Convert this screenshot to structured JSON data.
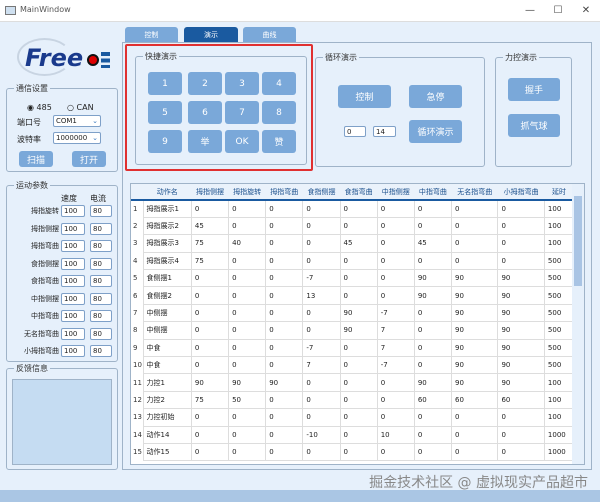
{
  "window": {
    "title": "MainWindow"
  },
  "tabs": [
    {
      "label": "控制"
    },
    {
      "label": "演示"
    },
    {
      "label": "曲线"
    }
  ],
  "logo": {
    "text": "Freelo"
  },
  "comm": {
    "title": "通信设置",
    "radio1": "485",
    "radio2": "CAN",
    "port_label": "端口号",
    "port_value": "COM1",
    "baud_label": "波特率",
    "baud_value": "1000000",
    "scan": "扫描",
    "open": "打开"
  },
  "motion": {
    "title": "运动参数",
    "col_speed": "速度",
    "col_current": "电流",
    "rows": [
      {
        "label": "拇指旋转",
        "speed": "100",
        "current": "80"
      },
      {
        "label": "拇指侧摆",
        "speed": "100",
        "current": "80"
      },
      {
        "label": "拇指弯曲",
        "speed": "100",
        "current": "80"
      },
      {
        "label": "食指侧摆",
        "speed": "100",
        "current": "80"
      },
      {
        "label": "食指弯曲",
        "speed": "100",
        "current": "80"
      },
      {
        "label": "中指侧摆",
        "speed": "100",
        "current": "80"
      },
      {
        "label": "中指弯曲",
        "speed": "100",
        "current": "80"
      },
      {
        "label": "无名指弯曲",
        "speed": "100",
        "current": "80"
      },
      {
        "label": "小拇指弯曲",
        "speed": "100",
        "current": "80"
      }
    ]
  },
  "feedback": {
    "title": "反馈信息"
  },
  "quick": {
    "title": "快捷演示",
    "keys": [
      "1",
      "2",
      "3",
      "4",
      "5",
      "6",
      "7",
      "8",
      "9",
      "举",
      "OK",
      "赞"
    ]
  },
  "loop": {
    "title": "循环演示",
    "control": "控制",
    "stop": "急停",
    "start_value": "0",
    "end_value": "14",
    "loop_btn": "循环演示"
  },
  "force": {
    "title": "力控演示",
    "grip": "握手",
    "ball": "抓气球"
  },
  "table": {
    "headers": [
      "动作名",
      "拇指侧摆",
      "拇指旋转",
      "拇指弯曲",
      "食指侧摆",
      "食指弯曲",
      "中指侧摆",
      "中指弯曲",
      "无名指弯曲",
      "小拇指弯曲",
      "延时"
    ],
    "rows": [
      [
        "1",
        "拇指展示1",
        "0",
        "0",
        "0",
        "0",
        "0",
        "0",
        "0",
        "0",
        "0",
        "100"
      ],
      [
        "2",
        "拇指展示2",
        "45",
        "0",
        "0",
        "0",
        "0",
        "0",
        "0",
        "0",
        "0",
        "100"
      ],
      [
        "3",
        "拇指展示3",
        "75",
        "40",
        "0",
        "0",
        "45",
        "0",
        "45",
        "0",
        "0",
        "100"
      ],
      [
        "4",
        "拇指展示4",
        "75",
        "0",
        "0",
        "0",
        "0",
        "0",
        "0",
        "0",
        "0",
        "500"
      ],
      [
        "5",
        "食侧摆1",
        "0",
        "0",
        "0",
        "-7",
        "0",
        "0",
        "90",
        "90",
        "90",
        "500"
      ],
      [
        "6",
        "食侧摆2",
        "0",
        "0",
        "0",
        "13",
        "0",
        "0",
        "90",
        "90",
        "90",
        "500"
      ],
      [
        "7",
        "中侧摆",
        "0",
        "0",
        "0",
        "0",
        "90",
        "-7",
        "0",
        "90",
        "90",
        "500"
      ],
      [
        "8",
        "中侧摆",
        "0",
        "0",
        "0",
        "0",
        "90",
        "7",
        "0",
        "90",
        "90",
        "500"
      ],
      [
        "9",
        "中食",
        "0",
        "0",
        "0",
        "-7",
        "0",
        "7",
        "0",
        "90",
        "90",
        "500"
      ],
      [
        "10",
        "中食",
        "0",
        "0",
        "0",
        "7",
        "0",
        "-7",
        "0",
        "90",
        "90",
        "500"
      ],
      [
        "11",
        "力控1",
        "90",
        "90",
        "90",
        "0",
        "0",
        "0",
        "90",
        "90",
        "90",
        "100"
      ],
      [
        "12",
        "力控2",
        "75",
        "50",
        "0",
        "0",
        "0",
        "0",
        "60",
        "60",
        "60",
        "100"
      ],
      [
        "13",
        "力控初始",
        "0",
        "0",
        "0",
        "0",
        "0",
        "0",
        "0",
        "0",
        "0",
        "100"
      ],
      [
        "14",
        "动作14",
        "0",
        "0",
        "0",
        "-10",
        "0",
        "10",
        "0",
        "0",
        "0",
        "1000"
      ],
      [
        "15",
        "动作15",
        "0",
        "0",
        "0",
        "0",
        "0",
        "0",
        "0",
        "0",
        "0",
        "1000"
      ]
    ]
  },
  "watermark": "掘金技术社区 @ 虚拟现实产品超市"
}
